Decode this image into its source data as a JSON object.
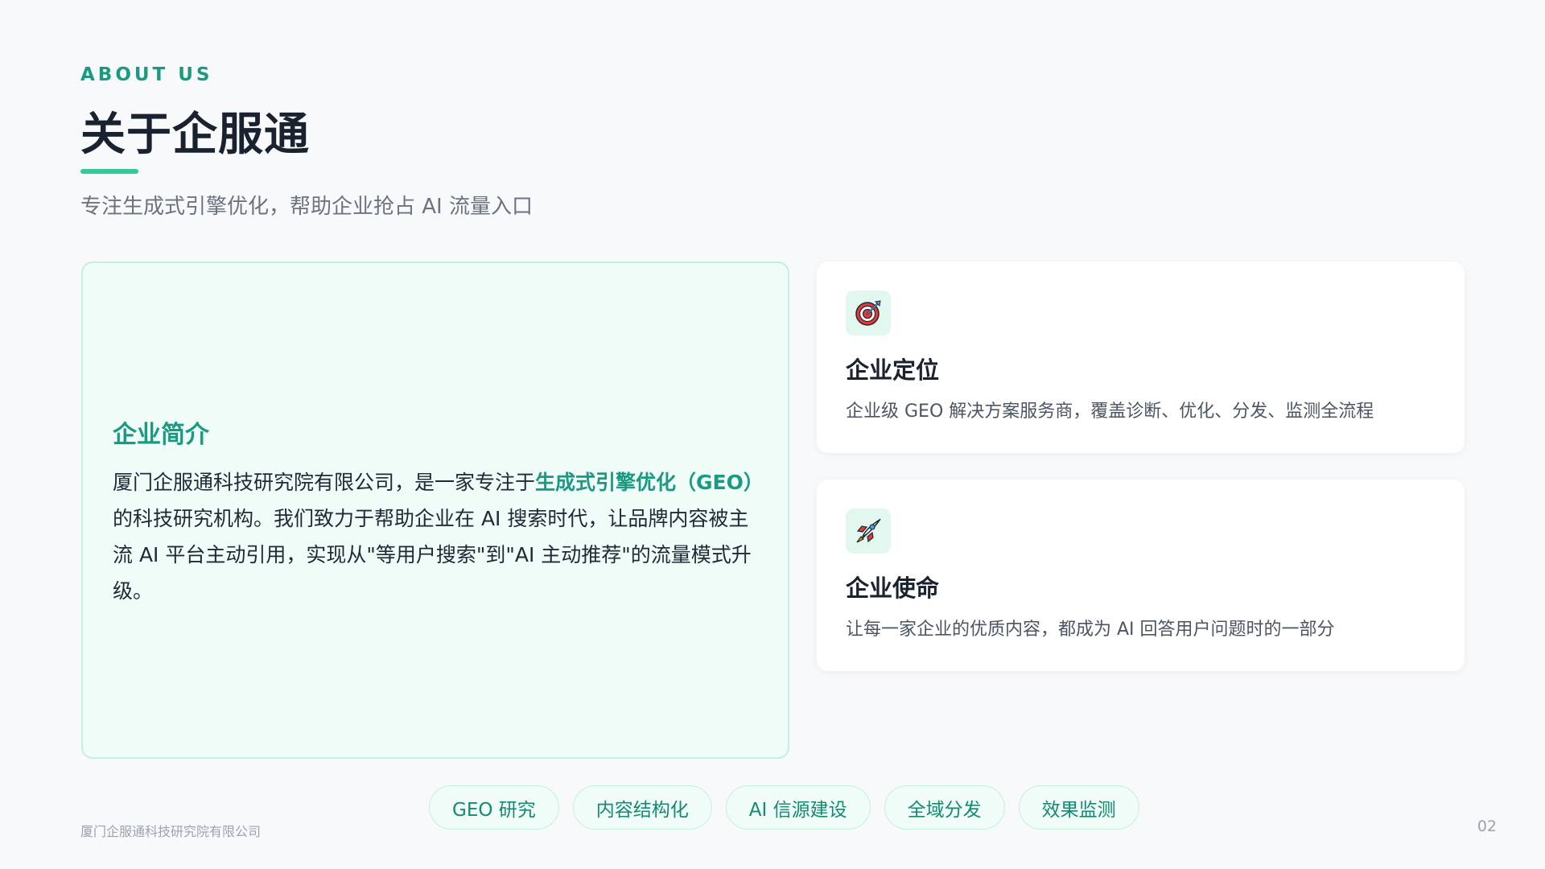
{
  "header": {
    "eyebrow": "ABOUT US",
    "title": "关于企服通",
    "subtitle": "专注生成式引擎优化，帮助企业抢占 AI 流量入口"
  },
  "intro": {
    "heading": "企业简介",
    "text_before": "厦门企服通科技研究院有限公司，是一家专注于",
    "text_highlight": "生成式引擎优化（GEO）",
    "text_after": "的科技研究机构。我们致力于帮助企业在 AI 搜索时代，让品牌内容被主流 AI 平台主动引用，实现从\"等用户搜索\"到\"AI 主动推荐\"的流量模式升级。"
  },
  "cards": [
    {
      "icon": "target-icon",
      "title": "企业定位",
      "desc": "企业级 GEO 解决方案服务商，覆盖诊断、优化、分发、监测全流程"
    },
    {
      "icon": "rocket-icon",
      "title": "企业使命",
      "desc": "让每一家企业的优质内容，都成为 AI 回答用户问题时的一部分"
    }
  ],
  "tags": [
    "GEO 研究",
    "内容结构化",
    "AI 信源建设",
    "全域分发",
    "效果监测"
  ],
  "footer": {
    "company": "厦门企服通科技研究院有限公司",
    "page_number": "02"
  },
  "colors": {
    "accent": "#1a9a80",
    "accent_bar": "#34c79b",
    "title": "#1a2230",
    "intro_bg": "#effcf7"
  }
}
